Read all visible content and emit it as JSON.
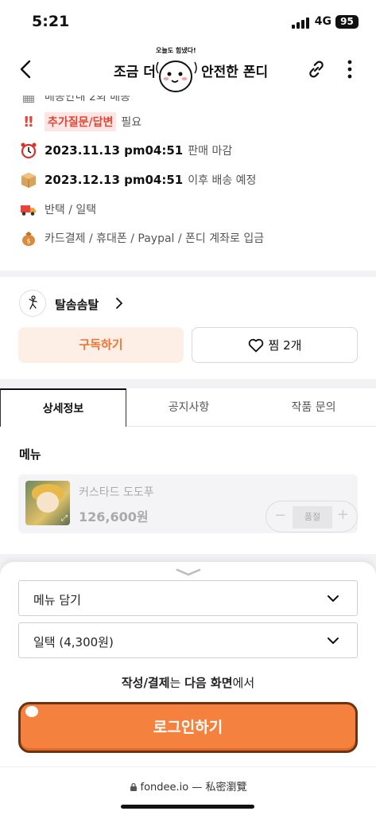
{
  "status_bar": {
    "time": "5:21",
    "network": "4G",
    "battery": "95"
  },
  "nav": {
    "title_left": "조금 더",
    "title_right": "안전한 폰디",
    "mascot_text": "오늘도 힘냈다!"
  },
  "info": {
    "partial_row": "배송안내 2회 배송",
    "question_label": "추가질문/답변",
    "question_suffix": "필요",
    "sale_end_date": "2023.11.13 pm04:51",
    "sale_end_suffix": "판매 마감",
    "ship_date": "2023.12.13 pm04:51",
    "ship_suffix": "이후 배송 예정",
    "delivery": "반택 / 일택",
    "payment": "카드결제 / 휴대폰 / Paypal / 폰디 계좌로 입금"
  },
  "creator": {
    "name": "탈솜솜탈",
    "subscribe_label": "구독하기",
    "like_label": "찜 2개"
  },
  "tabs": [
    {
      "label": "상세정보"
    },
    {
      "label": "공지사항"
    },
    {
      "label": "작품 문의"
    }
  ],
  "menu": {
    "heading": "메뉴",
    "item": {
      "name": "커스타드 도도푸",
      "price": "126,600원",
      "status": "품절"
    }
  },
  "sheet": {
    "menu_select": "메뉴 담기",
    "shipping_select": "일택 (4,300원)",
    "note_b1": "작성/결제",
    "note_t1": "는 ",
    "note_b2": "다음 화면",
    "note_t2": "에서",
    "login_label": "로그인하기"
  },
  "url_bar": {
    "url": "fondee.io — 私密瀏覽"
  },
  "colors": {
    "accent": "#f5813e",
    "alert_red": "#e24536",
    "subscribe_bg": "#fdeee6"
  }
}
